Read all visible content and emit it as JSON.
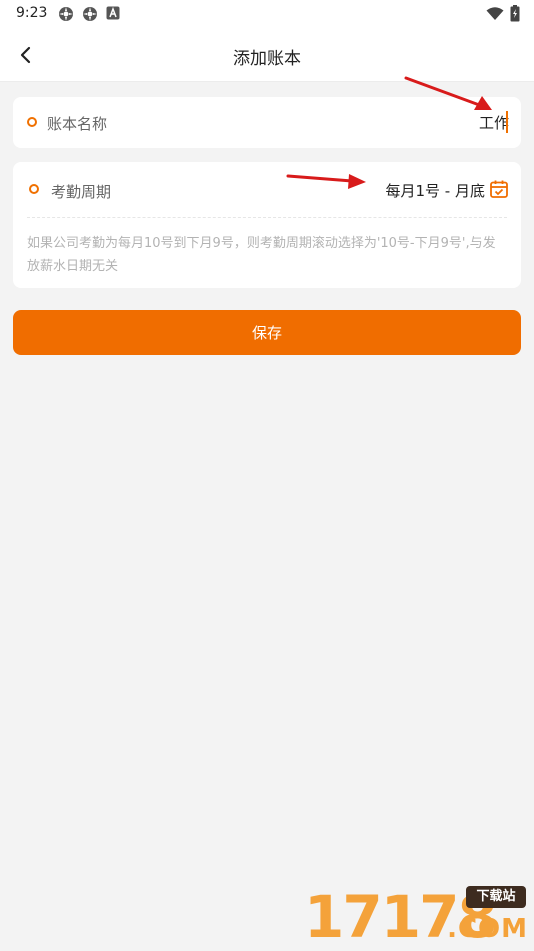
{
  "status_bar": {
    "time": "9:23",
    "icons_left": [
      "settings-gear-icon",
      "settings-gear-icon",
      "letter-a-icon"
    ],
    "icons_right": [
      "wifi-icon",
      "battery-charging-icon"
    ]
  },
  "header": {
    "title": "添加账本",
    "back_icon": "chevron-left-icon"
  },
  "form": {
    "name_field": {
      "label": "账本名称",
      "value": "工作"
    },
    "period_field": {
      "label": "考勤周期",
      "value": "每月1号 - 月底",
      "icon": "calendar-check-icon",
      "hint": "如果公司考勤为每月10号到下月9号，则考勤周期滚动选择为'10号-下月9号',与发放薪水日期无关"
    },
    "save_label": "保存"
  },
  "watermark": {
    "digits": "17178",
    "badge": "下载站",
    "suffix": ".COM"
  },
  "colors": {
    "accent": "#f06d00",
    "annotation_arrow": "#d81b1b",
    "background": "#f3f3f3"
  }
}
